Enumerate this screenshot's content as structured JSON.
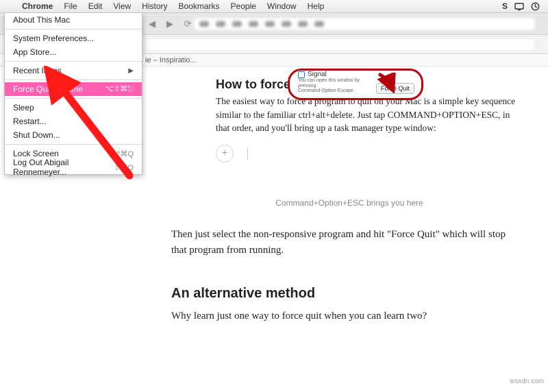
{
  "menubar": {
    "apple_glyph": "",
    "app": "Chrome",
    "items": [
      "File",
      "Edit",
      "View",
      "History",
      "Bookmarks",
      "People",
      "Window",
      "Help"
    ]
  },
  "menubar_right": {
    "wifi_icon": "wifi",
    "battery_icon": "battery",
    "clock_icon": "clock",
    "siri_letter": "S"
  },
  "apple_menu": {
    "about": "About This Mac",
    "prefs": "System Preferences...",
    "appstore": "App Store...",
    "recent": "Recent Items",
    "forcequit": "Force Quit Chrome",
    "forcequit_shortcut": "⌥⇧⌘⎋",
    "sleep": "Sleep",
    "restart": "Restart...",
    "shutdown": "Shut Down...",
    "lock": "Lock Screen",
    "lock_shortcut": "^⌘Q",
    "logout": "Log Out Abigail Rennemeyer...",
    "logout_shortcut": "⇧⌘Q"
  },
  "bookmarks_bar": {
    "item": "ie – Inspiratio..."
  },
  "fq_window": {
    "app": "Signal",
    "hint1": "You can open this window by pressing",
    "hint2": "Command-Option-Escape.",
    "button": "Force Quit"
  },
  "article": {
    "h1": "How to force qu",
    "p1": "The easiest way to force a program to quit on your Mac is a simple key sequence similar to the familiar ctrl+alt+delete. Just tap COMMAND+OPTION+ESC, in that order, and you'll bring up a task manager type window:",
    "caption": "Command+Option+ESC brings you here",
    "p2": "Then just select the non-responsive program and hit \"Force Quit\" which will stop that program from running.",
    "h2": "An alternative method",
    "p3": "Why learn just one way to force quit when you can learn two?"
  },
  "watermark": "wsxdn.com"
}
